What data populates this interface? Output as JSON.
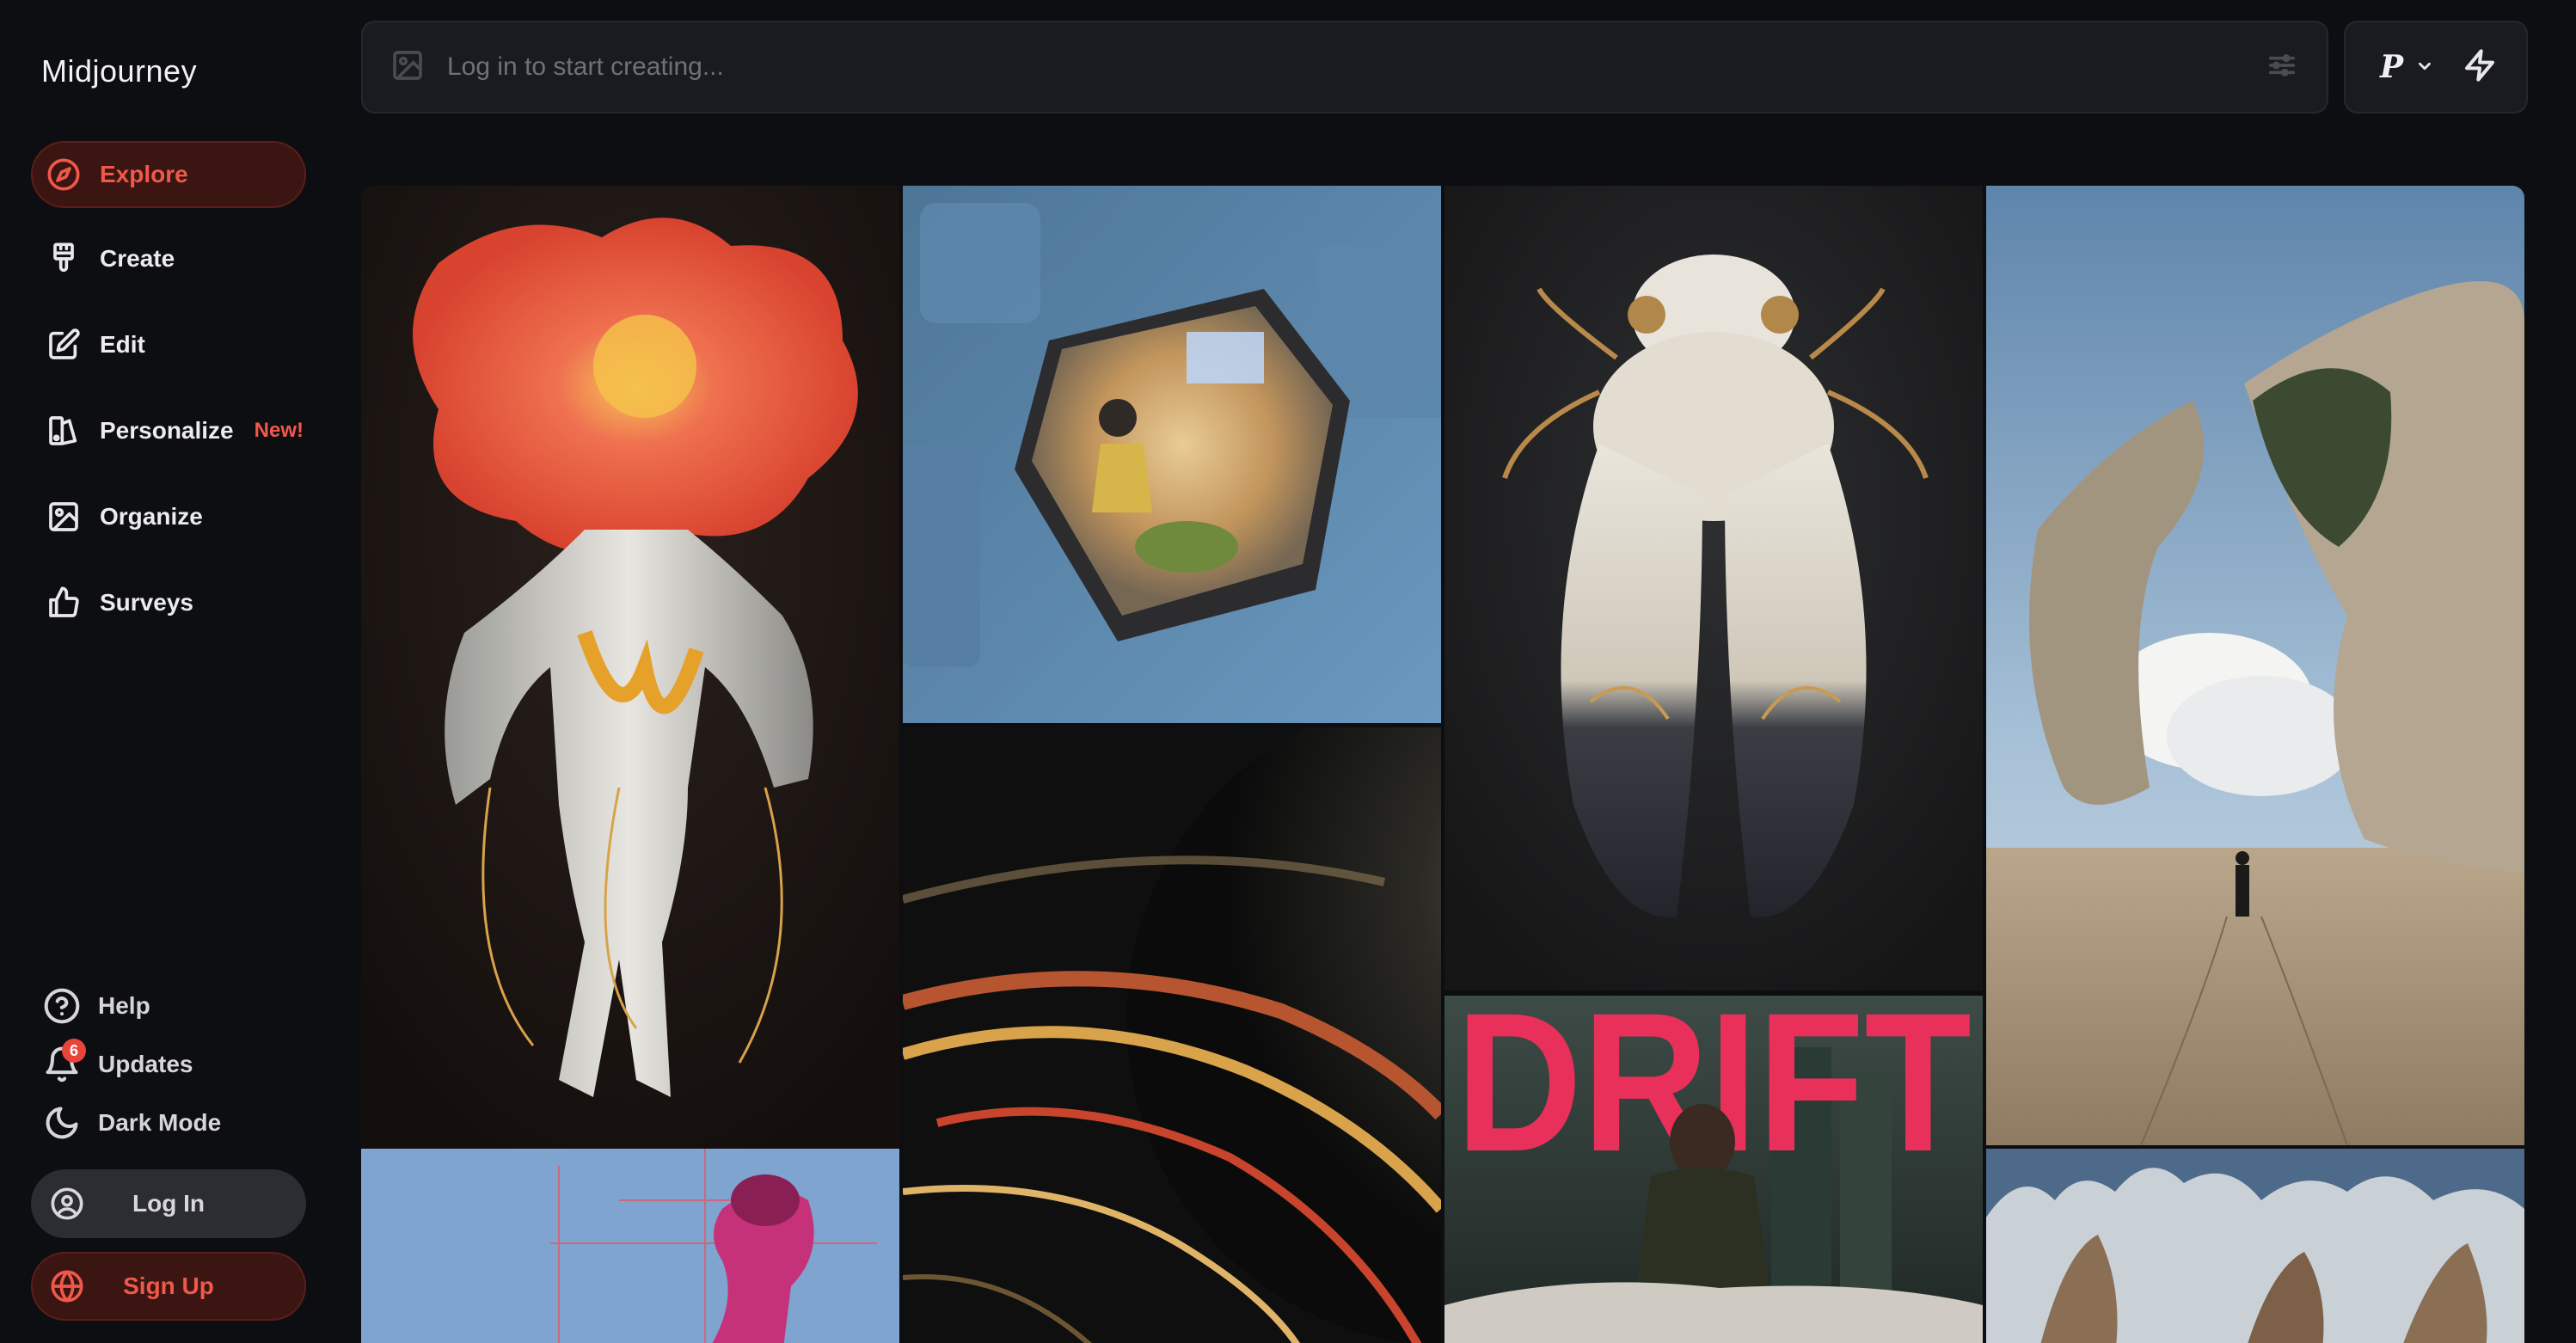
{
  "app": {
    "brand": "Midjourney"
  },
  "sidebar": {
    "nav": [
      {
        "label": "Explore",
        "icon": "compass-icon",
        "active": true
      },
      {
        "label": "Create",
        "icon": "paintbrush-icon"
      },
      {
        "label": "Edit",
        "icon": "edit-icon"
      },
      {
        "label": "Personalize",
        "icon": "personalize-icon",
        "badge": "New!"
      },
      {
        "label": "Organize",
        "icon": "image-icon"
      },
      {
        "label": "Surveys",
        "icon": "thumbs-up-icon"
      }
    ],
    "footer": [
      {
        "label": "Help",
        "icon": "help-circle-icon"
      },
      {
        "label": "Updates",
        "icon": "bell-icon",
        "count": "6"
      },
      {
        "label": "Dark Mode",
        "icon": "moon-icon"
      }
    ],
    "login_label": "Log In",
    "signup_label": "Sign Up"
  },
  "prompt": {
    "placeholder": "Log in to start creating..."
  },
  "tools": {
    "profile_letter": "P"
  },
  "gallery": {
    "drift_poster_text": "DRIFT"
  },
  "colors": {
    "accent": "#f0584a",
    "accent_bg": "#3a1512",
    "background": "#0d0e12",
    "panel": "#1a1b20"
  }
}
